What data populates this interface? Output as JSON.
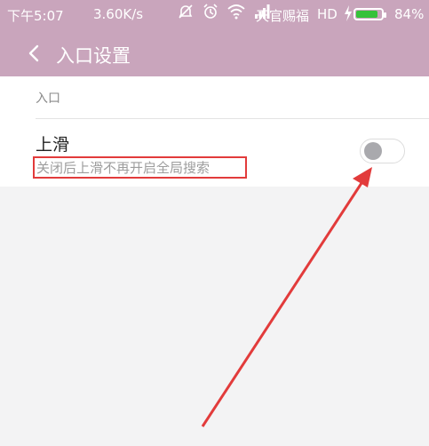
{
  "status_bar": {
    "time": "下午5:07",
    "speed": "3.60K/s",
    "carrier": "天官赐福",
    "network": "HD",
    "battery_pct": "84%",
    "battery_level": 0.84,
    "battery_color": "#36c23a",
    "icons": [
      "mute-icon",
      "alarm-icon",
      "wifi-icon",
      "signal-icon",
      "charging-icon",
      "battery-icon"
    ]
  },
  "header": {
    "title": "入口设置",
    "background": "#c9a5bc"
  },
  "section": {
    "header": "入口"
  },
  "setting": {
    "title": "上滑",
    "description": "关闭后上滑不再开启全局搜索",
    "toggle_on": false
  },
  "annotation": {
    "highlight_color": "#e23b3b"
  }
}
